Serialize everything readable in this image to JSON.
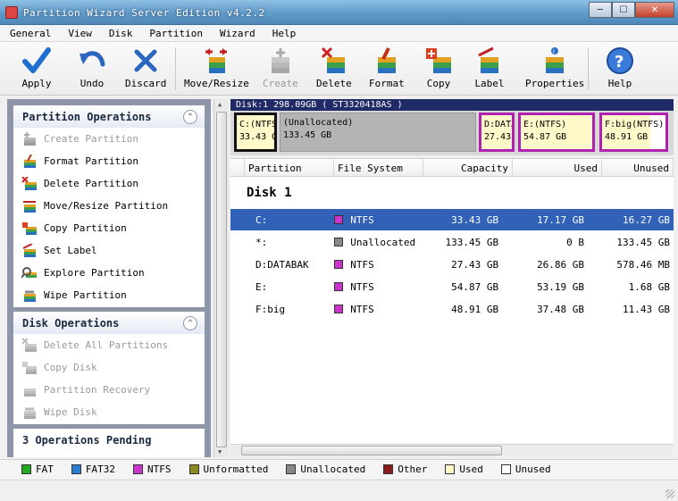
{
  "window": {
    "title": "Partition Wizard Server Edition v4.2.2"
  },
  "menu": [
    "General",
    "View",
    "Disk",
    "Partition",
    "Wizard",
    "Help"
  ],
  "toolbar": {
    "apply": "Apply",
    "undo": "Undo",
    "discard": "Discard",
    "move_resize": "Move/Resize",
    "create": "Create",
    "delete": "Delete",
    "format": "Format",
    "copy": "Copy",
    "label": "Label",
    "properties": "Properties",
    "help": "Help"
  },
  "partition_ops": {
    "title": "Partition Operations",
    "items": [
      "Create Partition",
      "Format Partition",
      "Delete Partition",
      "Move/Resize Partition",
      "Copy Partition",
      "Set Label",
      "Explore Partition",
      "Wipe Partition"
    ]
  },
  "disk_ops": {
    "title": "Disk Operations",
    "items": [
      "Delete All Partitions",
      "Copy Disk",
      "Partition Recovery",
      "Wipe Disk"
    ]
  },
  "pending": {
    "title": "3 Operations Pending"
  },
  "diskmap": {
    "header": "Disk:1  298.09GB  ( ST3320418AS )",
    "parts": [
      {
        "name": "C:(NTFS)",
        "size": "33.43 GB"
      },
      {
        "name": "(Unallocated)",
        "size": "133.45 GB"
      },
      {
        "name": "D:DATABAK(NTFS)",
        "size": "27.43 GB"
      },
      {
        "name": "E:(NTFS)",
        "size": "54.87 GB"
      },
      {
        "name": "F:big(NTFS)",
        "size": "48.91 GB"
      }
    ]
  },
  "list": {
    "columns": {
      "partition": "Partition",
      "fs": "File System",
      "capacity": "Capacity",
      "used": "Used",
      "unused": "Unused"
    },
    "disk_label": "Disk 1",
    "rows": [
      {
        "partition": "C:",
        "fs": "NTFS",
        "capacity": "33.43 GB",
        "used": "17.17 GB",
        "unused": "16.27 GB",
        "color": "#cc33cc"
      },
      {
        "partition": "*:",
        "fs": "Unallocated",
        "capacity": "133.45 GB",
        "used": "0 B",
        "unused": "133.45 GB",
        "color": "#888888"
      },
      {
        "partition": "D:DATABAK",
        "fs": "NTFS",
        "capacity": "27.43 GB",
        "used": "26.86 GB",
        "unused": "578.46 MB",
        "color": "#cc33cc"
      },
      {
        "partition": "E:",
        "fs": "NTFS",
        "capacity": "54.87 GB",
        "used": "53.19 GB",
        "unused": "1.68 GB",
        "color": "#cc33cc"
      },
      {
        "partition": "F:big",
        "fs": "NTFS",
        "capacity": "48.91 GB",
        "used": "37.48 GB",
        "unused": "11.43 GB",
        "color": "#cc33cc"
      }
    ]
  },
  "legend": [
    {
      "label": "FAT",
      "color": "#22aa22"
    },
    {
      "label": "FAT32",
      "color": "#2a7fd4"
    },
    {
      "label": "NTFS",
      "color": "#cc33cc"
    },
    {
      "label": "Unformatted",
      "color": "#8a8a20"
    },
    {
      "label": "Unallocated",
      "color": "#888888"
    },
    {
      "label": "Other",
      "color": "#8b1a1a"
    },
    {
      "label": "Used",
      "color": "#fff8c8"
    },
    {
      "label": "Unused",
      "color": "#ffffff"
    }
  ]
}
